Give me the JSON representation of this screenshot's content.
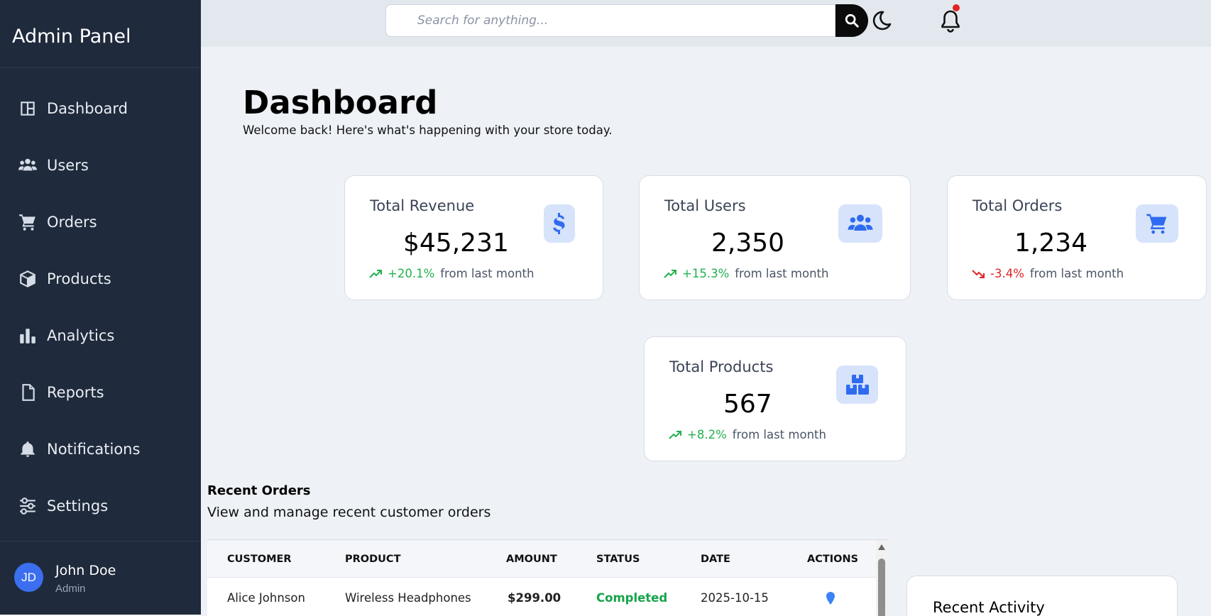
{
  "sidebar": {
    "brand": "Admin Panel",
    "items": [
      {
        "label": "Dashboard",
        "icon": "dashboard-icon"
      },
      {
        "label": "Users",
        "icon": "users-icon"
      },
      {
        "label": "Orders",
        "icon": "cart-icon"
      },
      {
        "label": "Products",
        "icon": "box-icon"
      },
      {
        "label": "Analytics",
        "icon": "bar-chart-icon"
      },
      {
        "label": "Reports",
        "icon": "file-icon"
      },
      {
        "label": "Notifications",
        "icon": "bell-icon"
      },
      {
        "label": "Settings",
        "icon": "sliders-icon"
      }
    ],
    "user": {
      "initials": "JD",
      "name": "John Doe",
      "role": "Admin"
    }
  },
  "topbar": {
    "search_placeholder": "Search for anything...",
    "has_unread_notifications": true
  },
  "header": {
    "title": "Dashboard",
    "subtitle": "Welcome back! Here's what's happening with your store today."
  },
  "stats": [
    {
      "title": "Total Revenue",
      "value": "$45,231",
      "change": "+20.1%",
      "trend": "up",
      "note": "from last month",
      "icon": "dollar-icon"
    },
    {
      "title": "Total Users",
      "value": "2,350",
      "change": "+15.3%",
      "trend": "up",
      "note": "from last month",
      "icon": "users-icon"
    },
    {
      "title": "Total Orders",
      "value": "1,234",
      "change": "-3.4%",
      "trend": "down",
      "note": "from last month",
      "icon": "cart-icon"
    },
    {
      "title": "Total Products",
      "value": "567",
      "change": "+8.2%",
      "trend": "up",
      "note": "from last month",
      "icon": "boxes-icon"
    }
  ],
  "recent_orders": {
    "title": "Recent Orders",
    "subtitle": "View and manage recent customer orders",
    "columns": [
      "CUSTOMER",
      "PRODUCT",
      "AMOUNT",
      "STATUS",
      "DATE",
      "ACTIONS"
    ],
    "rows": [
      {
        "customer": "Alice Johnson",
        "product": "Wireless Headphones",
        "amount": "$299.00",
        "status": "Completed",
        "date": "2025-10-15",
        "action_icon": "map-pin-icon"
      }
    ]
  },
  "recent_activity": {
    "title": "Recent Activity"
  },
  "colors": {
    "sidebar_bg": "#1f2a3c",
    "accent": "#2f6bf0",
    "positive": "#22b14c",
    "negative": "#e02424",
    "status_completed": "#16a34a"
  }
}
